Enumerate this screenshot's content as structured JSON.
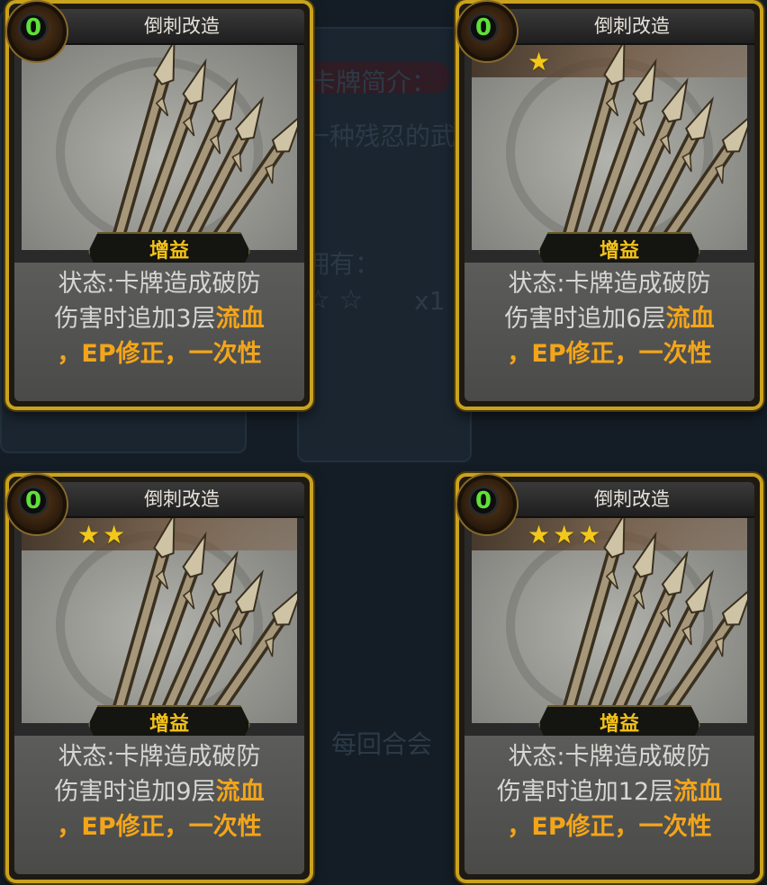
{
  "background": {
    "section_title": "卡牌简介：",
    "desc_fragment": "一种残忍的武",
    "owned_label": "拥有：",
    "owned_stars": "☆ ☆",
    "count": "x1",
    "bottom_fragment": "，每回合会"
  },
  "cards": [
    {
      "title": "倒刺改造",
      "cost": "0",
      "stars": "",
      "tag": "增益",
      "line1": "状态:卡牌造成破防",
      "line2_pre": "伤害时追加3层",
      "line2_hl": "流血",
      "line3": "，EP修正，一次性"
    },
    {
      "title": "倒刺改造",
      "cost": "0",
      "stars": "★",
      "tag": "增益",
      "line1": "状态:卡牌造成破防",
      "line2_pre": "伤害时追加6层",
      "line2_hl": "流血",
      "line3": "，EP修正，一次性"
    },
    {
      "title": "倒刺改造",
      "cost": "0",
      "stars": "★★",
      "tag": "增益",
      "line1": "状态:卡牌造成破防",
      "line2_pre": "伤害时追加9层",
      "line2_hl": "流血",
      "line3": "，EP修正，一次性"
    },
    {
      "title": "倒刺改造",
      "cost": "0",
      "stars": "★★★",
      "tag": "增益",
      "line1": "状态:卡牌造成破防",
      "line2_pre": "伤害时追加12层",
      "line2_hl": "流血",
      "line3": "，EP修正，一次性"
    }
  ]
}
